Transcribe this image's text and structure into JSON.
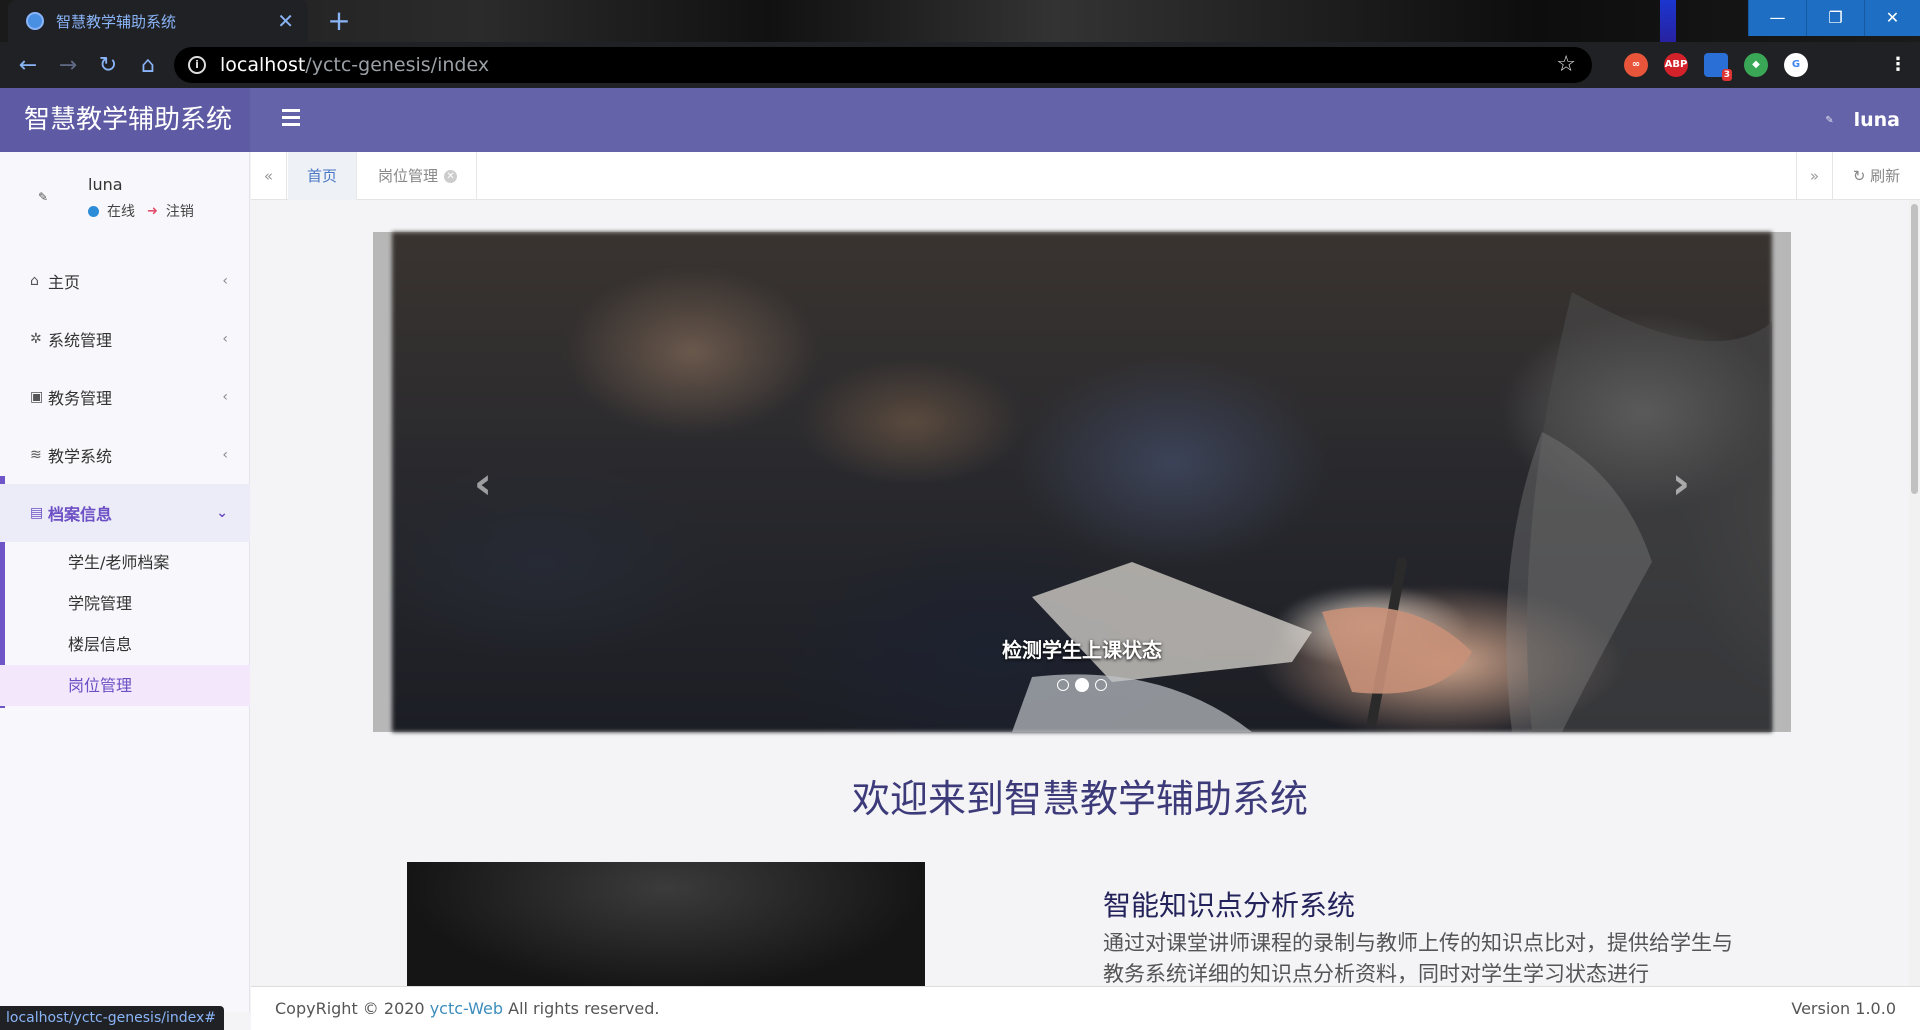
{
  "browser": {
    "tab_title": "智慧教学辅助系统",
    "tab_close": "✕",
    "new_tab": "+",
    "url_host": "localhost",
    "url_path": "/yctc-genesis/index",
    "status_url": "localhost/yctc-genesis/index#",
    "ext_abp": "ABP",
    "ext_badge": "3"
  },
  "header": {
    "logo": "智慧教学辅助系统",
    "user": "luna",
    "brand_color": "#6462a9"
  },
  "sidebar": {
    "user_name": "luna",
    "status_online": "在线",
    "logout": "注销",
    "items": [
      {
        "label": "主页",
        "icon": "home-icon",
        "glyph": "⌂"
      },
      {
        "label": "系统管理",
        "icon": "gear-icon",
        "glyph": "✲"
      },
      {
        "label": "教务管理",
        "icon": "id-card-icon",
        "glyph": "▣"
      },
      {
        "label": "教学系统",
        "icon": "rss-icon",
        "glyph": "≋"
      },
      {
        "label": "档案信息",
        "icon": "archive-icon",
        "glyph": "▤"
      }
    ],
    "subitems": [
      "学生/老师档案",
      "学院管理",
      "楼层信息",
      "岗位管理"
    ],
    "active_color": "#6c4fc4"
  },
  "tabs": {
    "home": "首页",
    "post": "岗位管理",
    "refresh": "刷新"
  },
  "carousel": {
    "caption": "检测学生上课状态",
    "slides": 3,
    "active_slide": 2
  },
  "main": {
    "welcome": "欢迎来到智慧教学辅助系统",
    "feature_title": "智能知识点分析系统",
    "feature_text": "通过对课堂讲师课程的录制与教师上传的知识点比对，提供给学生与教务系统详细的知识点分析资料，同时对学生学习状态进行"
  },
  "footer": {
    "copyright_prefix": "CopyRight © 2020 ",
    "brand_link": "yctc-Web",
    "copyright_suffix": " All rights reserved.",
    "version": "Version 1.0.0"
  }
}
